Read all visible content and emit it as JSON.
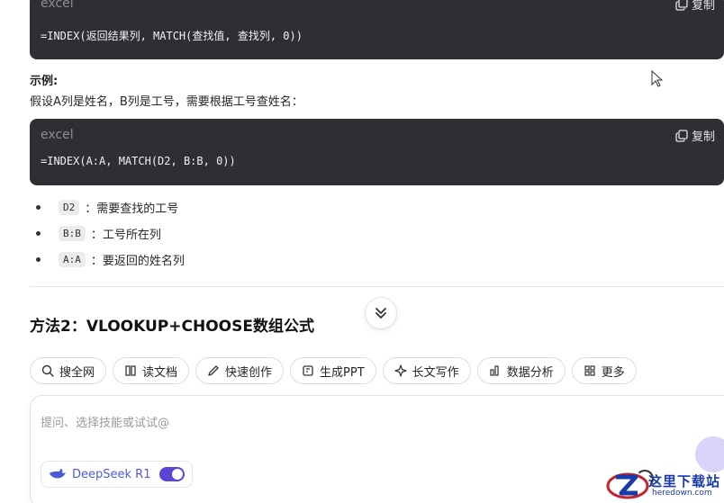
{
  "code_blocks": [
    {
      "lang": "excel",
      "copy_label": "复制",
      "code": "=INDEX(返回结果列, MATCH(查找值, 查找列, 0))"
    },
    {
      "lang": "excel",
      "copy_label": "复制",
      "code": "=INDEX(A:A, MATCH(D2, B:B, 0))"
    }
  ],
  "example_heading": "示例:",
  "example_text": "假设A列是姓名，B列是工号，需要根据工号查姓名：",
  "bullets": [
    {
      "code": "D2",
      "text": "：需要查找的工号"
    },
    {
      "code": "B:B",
      "text": "：工号所在列"
    },
    {
      "code": "A:A",
      "text": "：要返回的姓名列"
    }
  ],
  "section_title": "方法2：VLOOKUP+CHOOSE数组公式",
  "chips": [
    {
      "label": "搜全网",
      "icon": "search-icon"
    },
    {
      "label": "读文档",
      "icon": "book-icon"
    },
    {
      "label": "快速创作",
      "icon": "pen-icon"
    },
    {
      "label": "生成PPT",
      "icon": "ppt-icon"
    },
    {
      "label": "长文写作",
      "icon": "sparkle-icon"
    },
    {
      "label": "数据分析",
      "icon": "chart-icon"
    },
    {
      "label": "更多",
      "icon": "grid-icon"
    }
  ],
  "input": {
    "placeholder": "提问、选择技能或试试@"
  },
  "model": {
    "label": "DeepSeek R1",
    "enabled": true
  },
  "watermark": {
    "title": "这里下载站",
    "subtitle": "heredown.com"
  },
  "colors": {
    "code_bg": "#2f2f33",
    "accent": "#5b45d8",
    "model_text": "#4d5bd9"
  }
}
